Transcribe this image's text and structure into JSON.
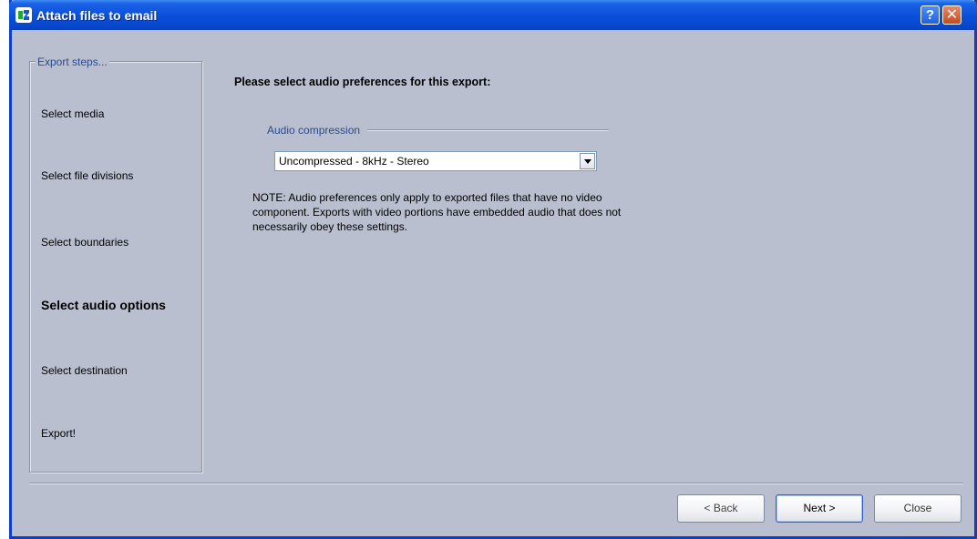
{
  "window": {
    "title": "Attach files to email",
    "help_label": "?",
    "close_label": "✕"
  },
  "steps": {
    "legend": "Export steps...",
    "items": [
      {
        "label": "Select media"
      },
      {
        "label": "Select file divisions"
      },
      {
        "label": "Select boundaries"
      },
      {
        "label": "Select audio options",
        "active": true
      },
      {
        "label": "Select destination"
      },
      {
        "label": "Export!"
      }
    ]
  },
  "main": {
    "heading": "Please select audio preferences for this export:",
    "compression": {
      "legend": "Audio compression",
      "selected": "Uncompressed - 8kHz - Stereo"
    },
    "note": "NOTE: Audio preferences only apply to exported files that have no video component.  Exports with video portions have embedded audio that does not necessarily obey these settings."
  },
  "buttons": {
    "back": "< Back",
    "next": "Next >",
    "close": "Close"
  },
  "colors": {
    "titlebar": "#0a4fd9",
    "dialog_bg": "#b9bfce",
    "group_legend": "#2b4a8c"
  },
  "icons": {
    "app": "app-logo-icon",
    "help": "help-icon",
    "close": "close-icon",
    "dropdown": "chevron-down-icon"
  }
}
